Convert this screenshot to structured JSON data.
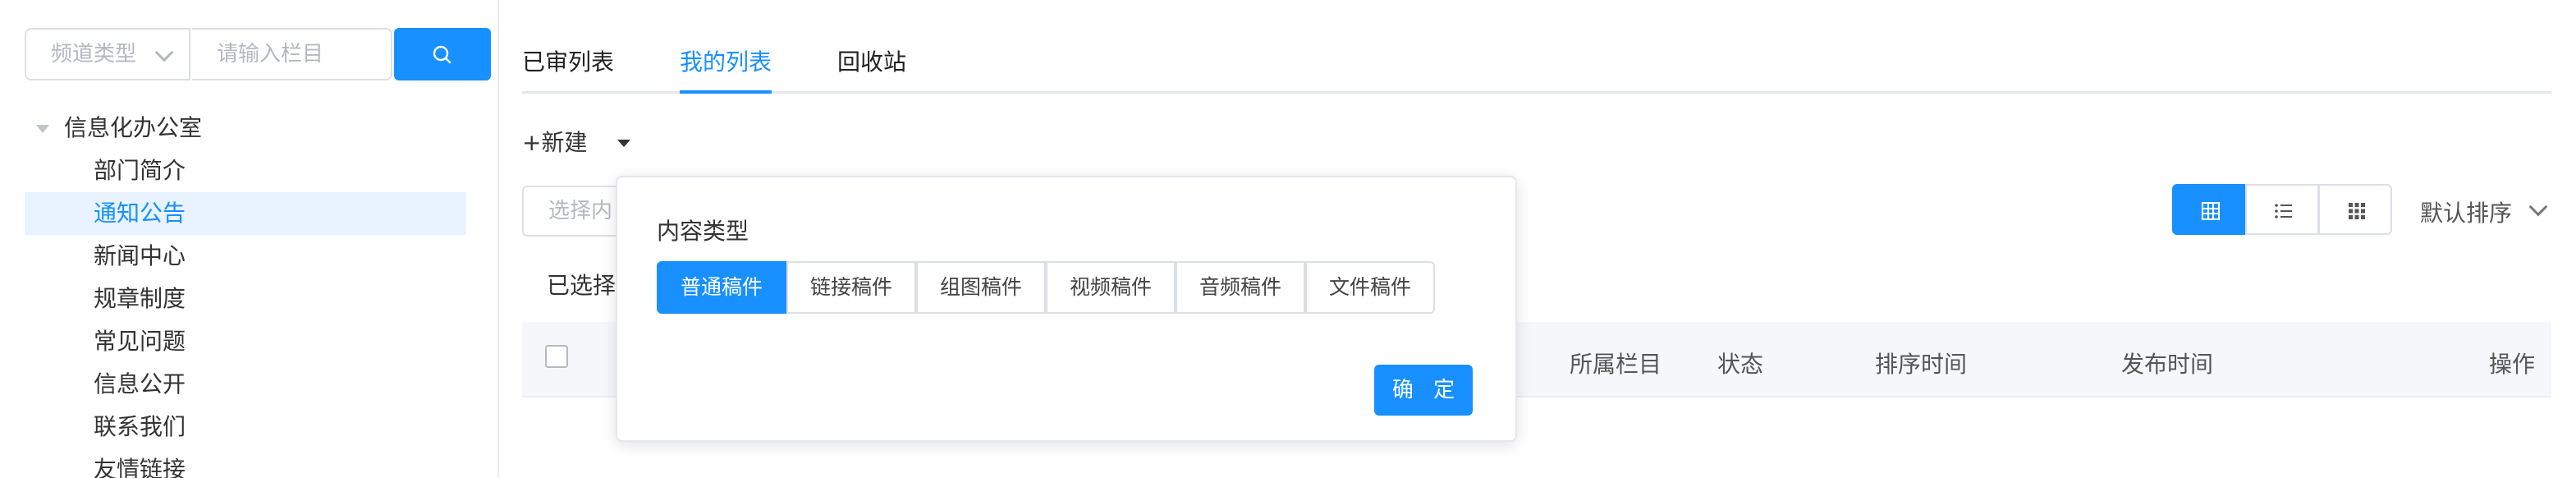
{
  "sidebar": {
    "channel_select": {
      "placeholder": "频道类型",
      "chevron_icon": "chevron-down-icon"
    },
    "column_search": {
      "placeholder": "请输入栏目"
    },
    "search_button": {
      "icon": "search-icon"
    },
    "tree": {
      "root": {
        "label": "信息化办公室",
        "expanded": true
      },
      "items": [
        {
          "label": "部门简介",
          "active": false
        },
        {
          "label": "通知公告",
          "active": true
        },
        {
          "label": "新闻中心",
          "active": false
        },
        {
          "label": "规章制度",
          "active": false
        },
        {
          "label": "常见问题",
          "active": false
        },
        {
          "label": "信息公开",
          "active": false
        },
        {
          "label": "联系我们",
          "active": false
        },
        {
          "label": "友情链接",
          "active": false
        }
      ]
    }
  },
  "tabs": [
    {
      "label": "已审列表",
      "active": false
    },
    {
      "label": "我的列表",
      "active": true
    },
    {
      "label": "回收站",
      "active": false
    }
  ],
  "toolbar": {
    "new_label": "+新建",
    "content_select_placeholder": "选择内",
    "selected_label": "已选择"
  },
  "table": {
    "headers": [
      "所属栏目",
      "状态",
      "排序时间",
      "发布时间",
      "操作"
    ]
  },
  "view_modes": [
    {
      "icon": "grid-view-icon",
      "active": true
    },
    {
      "icon": "list-view-icon",
      "active": false
    },
    {
      "icon": "apps-view-icon",
      "active": false
    }
  ],
  "sort": {
    "label": "默认排序"
  },
  "popup": {
    "title": "内容类型",
    "types": [
      {
        "label": "普通稿件",
        "active": true
      },
      {
        "label": "链接稿件",
        "active": false
      },
      {
        "label": "组图稿件",
        "active": false
      },
      {
        "label": "视频稿件",
        "active": false
      },
      {
        "label": "音频稿件",
        "active": false
      },
      {
        "label": "文件稿件",
        "active": false
      }
    ],
    "confirm_label": "确 定"
  },
  "colors": {
    "accent": "#1890ff",
    "active_bg": "#e8f3ff",
    "header_bg": "#f5f7fa"
  }
}
